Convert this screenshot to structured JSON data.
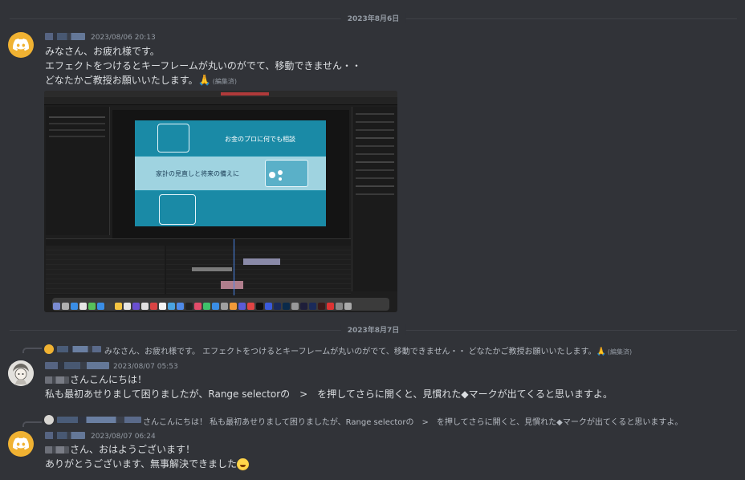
{
  "dividers": {
    "first": "2023年8月6日",
    "second": "2023年8月7日"
  },
  "message1": {
    "timestamp": "2023/08/06 20:13",
    "line1": "みなさん、お疲れ様です。",
    "line2": "エフェクトをつけるとキーフレームが丸いのがでて、移動できません・・",
    "line3": "どなたかご教授お願いいたします。",
    "pray_emoji": "🙏",
    "edited": "(編集済)"
  },
  "attachment": {
    "comp_text1": "お金のプロに何でも相談",
    "comp_text2": "家計の見直しと将来の備えに"
  },
  "message2": {
    "reply_text": "みなさん、お疲れ様です。 エフェクトをつけるとキーフレームが丸いのがでて、移動できません・・ どなたかご教授お願いいたします。",
    "reply_pray": "🙏",
    "reply_edited": "(編集済)",
    "timestamp": "2023/08/07 05:53",
    "line1": "さんこんにちは！",
    "line2": "私も最初あせりまして困りましたが、Range selectorの　>　を押してさらに開くと、見慣れた◆マークが出てくると思いますよ。"
  },
  "message3": {
    "reply_text": "さんこんにちは！ 私も最初あせりまして困りましたが、Range selectorの　>　を押してさらに開くと、見慣れた◆マークが出てくると思いますよ。",
    "timestamp": "2023/08/07 06:24",
    "line1": "さん、おはようございます！",
    "line2": "ありがとうございます、無事解決できました"
  },
  "icons": {
    "avatar_discord": "discord-logo-icon",
    "avatar_anime": "anime-avatar-icon",
    "laugh": "grinning-sweat-emoji-icon"
  },
  "colors": {
    "background": "#313338",
    "discord_avatar": "#f0b232",
    "timestamp": "#949ba4"
  }
}
